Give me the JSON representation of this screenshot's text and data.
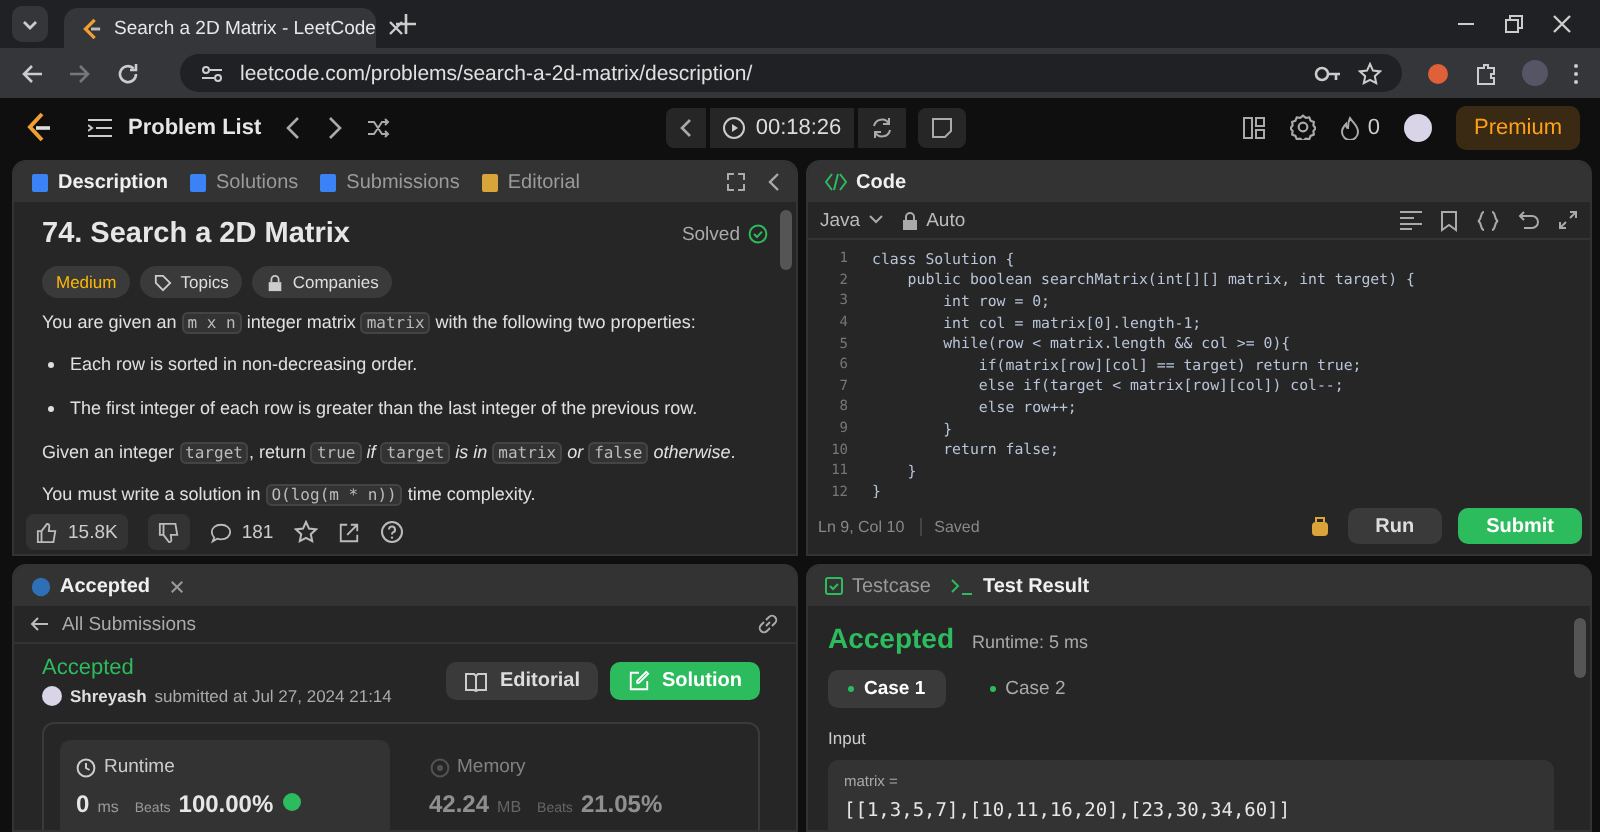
{
  "browser": {
    "tab_title": "Search a 2D Matrix - LeetCode",
    "url": "leetcode.com/problems/search-a-2d-matrix/description/"
  },
  "nav": {
    "problem_list": "Problem List",
    "timer": "00:18:26",
    "streak": "0",
    "premium": "Premium"
  },
  "description": {
    "tabs": [
      {
        "label": "Description",
        "selected": true
      },
      {
        "label": "Solutions",
        "selected": false
      },
      {
        "label": "Submissions",
        "selected": false
      },
      {
        "label": "Editorial",
        "selected": false
      }
    ],
    "title": "74. Search a 2D Matrix",
    "status": "Solved",
    "difficulty": "Medium",
    "tags": [
      "Topics",
      "Companies"
    ],
    "paragraphs": [
      {
        "kind": "text",
        "segments": [
          {
            "kind": "text",
            "text": "You are given an "
          },
          {
            "kind": "code",
            "text": "m x n"
          },
          {
            "kind": "text",
            "text": " integer matrix "
          },
          {
            "kind": "code",
            "text": "matrix"
          },
          {
            "kind": "text",
            "text": " with the following two properties:"
          }
        ]
      },
      {
        "kind": "bullet",
        "segments": [
          {
            "kind": "text",
            "text": "Each row is sorted in non-decreasing order."
          }
        ]
      },
      {
        "kind": "bullet",
        "segments": [
          {
            "kind": "text",
            "text": "The first integer of each row is greater than the last integer of the previous row."
          }
        ]
      },
      {
        "kind": "text",
        "segments": [
          {
            "kind": "text",
            "text": "Given an integer "
          },
          {
            "kind": "code",
            "text": "target"
          },
          {
            "kind": "text",
            "text": ", return "
          },
          {
            "kind": "code",
            "text": "true"
          },
          {
            "kind": "italic",
            "text": " if "
          },
          {
            "kind": "code",
            "text": "target"
          },
          {
            "kind": "italic",
            "text": " is in "
          },
          {
            "kind": "code",
            "text": "matrix"
          },
          {
            "kind": "italic",
            "text": " or "
          },
          {
            "kind": "code",
            "text": "false"
          },
          {
            "kind": "italic",
            "text": " otherwise"
          },
          {
            "kind": "text",
            "text": "."
          }
        ]
      },
      {
        "kind": "text",
        "segments": [
          {
            "kind": "text",
            "text": "You must write a solution in "
          },
          {
            "kind": "code",
            "text": "O(log(m * n))"
          },
          {
            "kind": "text",
            "text": " time complexity."
          }
        ]
      }
    ],
    "likes": "15.8K",
    "comments": "181"
  },
  "code": {
    "title": "Code",
    "language": "Java",
    "mode": "Auto",
    "lines": [
      {
        "number": "1",
        "text": "class Solution {"
      },
      {
        "number": "2",
        "text": "    public boolean searchMatrix(int[][] matrix, int target) {"
      },
      {
        "number": "3",
        "text": "        int row = 0;"
      },
      {
        "number": "4",
        "text": "        int col = matrix[0].length-1;"
      },
      {
        "number": "5",
        "text": "        while(row < matrix.length && col >= 0){"
      },
      {
        "number": "6",
        "text": "            if(matrix[row][col] == target) return true;"
      },
      {
        "number": "7",
        "text": "            else if(target < matrix[row][col]) col--;"
      },
      {
        "number": "8",
        "text": "            else row++;"
      },
      {
        "number": "9",
        "text": "        }"
      },
      {
        "number": "10",
        "text": "        return false;"
      },
      {
        "number": "11",
        "text": "    }"
      },
      {
        "number": "12",
        "text": "}"
      }
    ],
    "cursor": "Ln 9, Col 10",
    "saved": "Saved",
    "run": "Run",
    "submit": "Submit"
  },
  "submission": {
    "tab": "Accepted",
    "back": "All Submissions",
    "result": "Accepted",
    "user": "Shreyash",
    "submitted": "submitted at Jul 27, 2024 21:14",
    "editorial": "Editorial",
    "solution": "Solution",
    "runtime": {
      "label": "Runtime",
      "value": "0",
      "unit": "ms",
      "beats": "Beats",
      "percent": "100.00%"
    },
    "memory": {
      "label": "Memory",
      "value": "42.24",
      "unit": "MB",
      "beats": "Beats",
      "percent": "21.05%"
    }
  },
  "result": {
    "tabs": [
      {
        "label": "Testcase",
        "selected": false
      },
      {
        "label": "Test Result",
        "selected": true
      }
    ],
    "status": "Accepted",
    "runtime": "Runtime: 5 ms",
    "cases": [
      {
        "label": "Case 1",
        "selected": true
      },
      {
        "label": "Case 2",
        "selected": false
      }
    ],
    "input_label": "Input",
    "variable": "matrix =",
    "value": "[[1,3,5,7],[10,11,16,20],[23,30,34,60]]"
  }
}
